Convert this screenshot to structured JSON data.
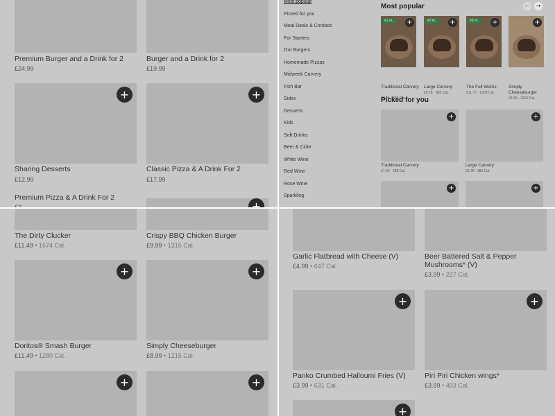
{
  "top_left": {
    "cards": [
      {
        "title": "Premium Burger and a Drink for 2",
        "price": "£24.99",
        "cal": ""
      },
      {
        "title": "Burger and a Drink for 2",
        "price": "£19.99",
        "cal": ""
      },
      {
        "title": "Sharing Desserts",
        "price": "£12.99",
        "cal": ""
      },
      {
        "title": "Classic Pizza & A Drink For 2",
        "price": "£17.99",
        "cal": ""
      },
      {
        "title": "Premium Pizza & A Drink For 2",
        "price": "£2",
        "cal": ""
      }
    ],
    "plus": "+"
  },
  "sidebar": {
    "items": [
      "Most popular",
      "Picked for you",
      "Meal Deals & Combos",
      "For Starters",
      "Our Burgers",
      "Homemade Pizzas",
      "Midweek Carvery",
      "Fish Bar",
      "Sides",
      "Desserts",
      "Kids",
      "Soft Drinks",
      "Beer & Cider",
      "White Wine",
      "Red Wine",
      "Rose Wine",
      "Sparkling"
    ],
    "active_index": 0
  },
  "most_popular": {
    "title": "Most popular",
    "prev_arrow": "←",
    "next_arrow": "→",
    "items": [
      {
        "badge": "#1 m..",
        "name": "Traditional Carvery",
        "price": "£7.99 · 338 Cal."
      },
      {
        "badge": "#2 m..",
        "name": "Large Carvery",
        "price": "£9.78 · 983 Cal."
      },
      {
        "badge": "#3 m..",
        "name": "The Full Works",
        "price": "£11.77 · 1208 Cal."
      },
      {
        "badge": "",
        "name": "Simply Cheeseburger",
        "price": "£8.99 · 1215 Cal."
      }
    ]
  },
  "picked_for_you": {
    "title": "Picked for you",
    "items": [
      {
        "name": "Traditional Carvery",
        "price": "£7.99 · 338 Cal."
      },
      {
        "name": "Large Carvery",
        "price": "£9.78 · 983 Cal."
      }
    ]
  },
  "bottom_left": {
    "cards": [
      {
        "title": "The Dirty Clucker",
        "price": "£11.49",
        "cal": "1674 Cal."
      },
      {
        "title": "Crispy BBQ Chicken Burger",
        "price": "£9.99",
        "cal": "1316 Cal."
      },
      {
        "title": "Doritos® Smash Burger",
        "price": "£11.49",
        "cal": "1280 Cal."
      },
      {
        "title": "Simply Cheeseburger",
        "price": "£8.99",
        "cal": "1215 Cal."
      }
    ]
  },
  "bottom_right": {
    "cards": [
      {
        "title": "Garlic Flatbread with Cheese (V)",
        "title2": "",
        "price": "£4.99",
        "cal": "647 Cal."
      },
      {
        "title": "Beer Battered Salt & Pepper",
        "title2": "Mushrooms* (V)",
        "price": "£3.99",
        "cal": "227 Cal."
      },
      {
        "title": "Panko Crumbed Halloumi Fries (V)",
        "title2": "",
        "price": "£3.99",
        "cal": "631 Cal."
      },
      {
        "title": "Piri Piri Chicken wings*",
        "title2": "",
        "price": "£3.99",
        "cal": "403 Cal."
      }
    ]
  },
  "separator": " • "
}
